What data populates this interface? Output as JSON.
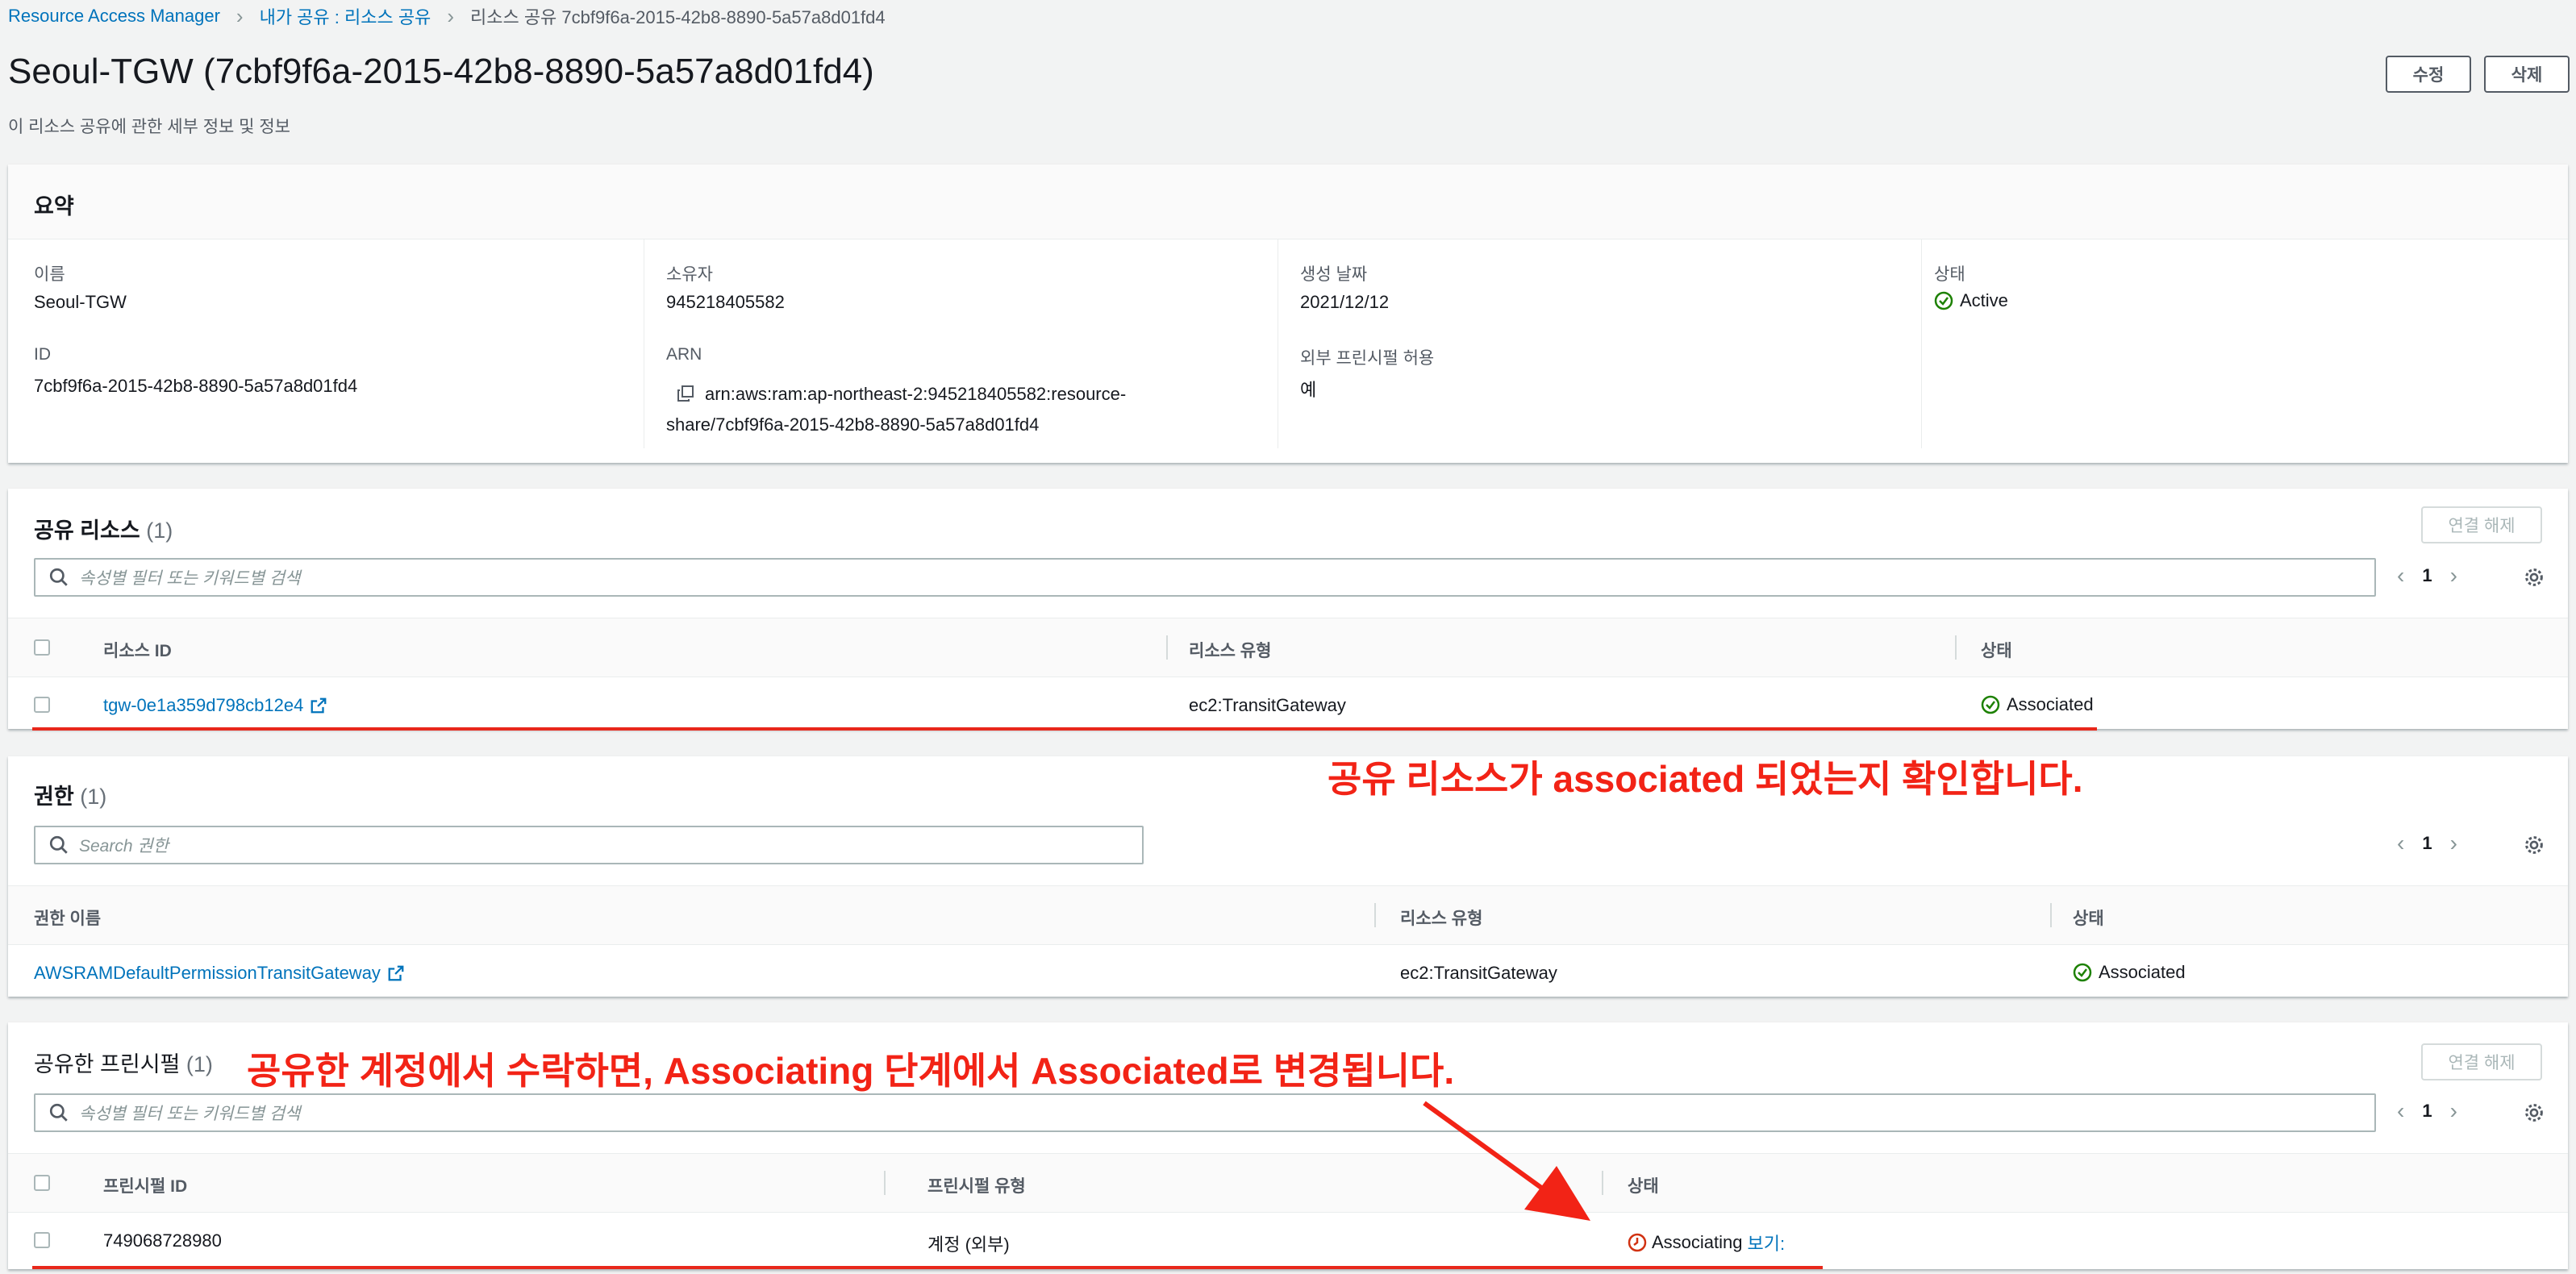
{
  "breadcrumb": {
    "root": "Resource Access Manager",
    "parent": "내가 공유 : 리소스 공유",
    "current": "리소스 공유 7cbf9f6a-2015-42b8-8890-5a57a8d01fd4"
  },
  "page": {
    "title": "Seoul-TGW (7cbf9f6a-2015-42b8-8890-5a57a8d01fd4)",
    "subtitle": "이 리소스 공유에 관한 세부 정보 및 정보",
    "edit_label": "수정",
    "delete_label": "삭제"
  },
  "summary": {
    "title": "요약",
    "name_label": "이름",
    "name_value": "Seoul-TGW",
    "id_label": "ID",
    "id_value": "7cbf9f6a-2015-42b8-8890-5a57a8d01fd4",
    "owner_label": "소유자",
    "owner_value": "945218405582",
    "arn_label": "ARN",
    "arn_line1": "arn:aws:ram:ap-northeast-2:945218405582:resource-",
    "arn_line2": "share/7cbf9f6a-2015-42b8-8890-5a57a8d01fd4",
    "created_label": "생성 날짜",
    "created_value": "2021/12/12",
    "external_label": "외부 프린시펄 허용",
    "external_value": "예",
    "status_label": "상태",
    "status_value": "Active"
  },
  "shared_resources": {
    "title": "공유 리소스",
    "count": "(1)",
    "disassociate_label": "연결 해제",
    "search_placeholder": "속성별 필터 또는 키워드별 검색",
    "page": "1",
    "columns": [
      "리소스 ID",
      "리소스 유형",
      "상태"
    ],
    "rows": [
      {
        "id": "tgw-0e1a359d798cb12e4",
        "type": "ec2:TransitGateway",
        "status": "Associated"
      }
    ]
  },
  "permissions": {
    "title": "권한",
    "count": "(1)",
    "search_placeholder": "Search 권한",
    "page": "1",
    "columns": [
      "권한 이름",
      "리소스 유형",
      "상태"
    ],
    "rows": [
      {
        "name": "AWSRAMDefaultPermissionTransitGateway",
        "type": "ec2:TransitGateway",
        "status": "Associated"
      }
    ]
  },
  "principals": {
    "title": "공유한 프린시펄",
    "count": "(1)",
    "disassociate_label": "연결 해제",
    "search_placeholder": "속성별 필터 또는 키워드별 검색",
    "page": "1",
    "columns": [
      "프린시펄 ID",
      "프린시펄 유형",
      "상태"
    ],
    "rows": [
      {
        "id": "749068728980",
        "type": "계정 (외부)",
        "status": "Associating",
        "status_link": "보기:"
      }
    ]
  },
  "annotations": {
    "resource_note": "공유 리소스가 associated 되었는지 확인합니다.",
    "principal_note": "공유한 계정에서 수락하면, Associating 단계에서 Associated로 변경됩니다."
  },
  "colors": {
    "link": "#0073bb",
    "success": "#1d8102",
    "error": "#d13212",
    "annotation": "#f22316"
  }
}
